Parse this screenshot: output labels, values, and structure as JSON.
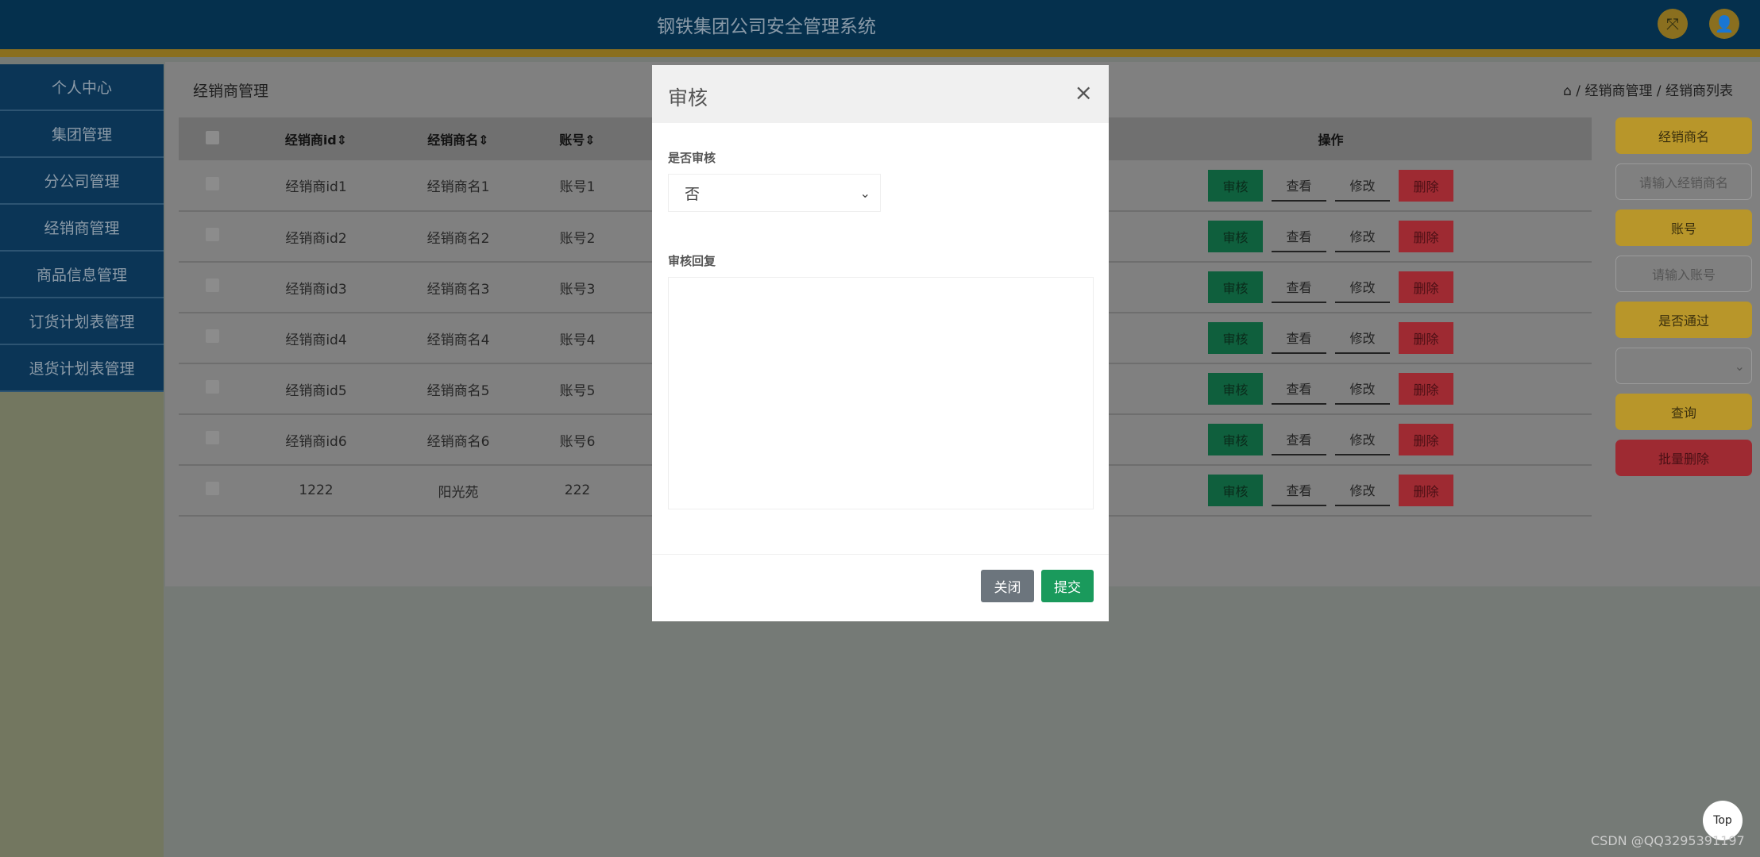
{
  "header": {
    "title": "钢铁集团公司安全管理系统",
    "icons": [
      "fullscreen-icon",
      "user-icon"
    ]
  },
  "sidebar": {
    "items": [
      "个人中心",
      "集团管理",
      "分公司管理",
      "经销商管理",
      "商品信息管理",
      "订货计划表管理",
      "退货计划表管理"
    ]
  },
  "page": {
    "title": "经销商管理",
    "breadcrumb": [
      "经销商管理",
      "经销商列表"
    ]
  },
  "table": {
    "columns": [
      "经销商id",
      "经销商名",
      "账号",
      "操作"
    ],
    "rows": [
      [
        "经销商id1",
        "经销商名1",
        "账号1"
      ],
      [
        "经销商id2",
        "经销商名2",
        "账号2"
      ],
      [
        "经销商id3",
        "经销商名3",
        "账号3"
      ],
      [
        "经销商id4",
        "经销商名4",
        "账号4"
      ],
      [
        "经销商id5",
        "经销商名5",
        "账号5"
      ],
      [
        "经销商id6",
        "经销商名6",
        "账号6"
      ],
      [
        "1222",
        "阳光苑",
        "222"
      ]
    ],
    "actions": [
      "审核",
      "查看",
      "修改",
      "删除"
    ]
  },
  "search": {
    "name_label": "经销商名",
    "name_placeholder": "请输入经销商名",
    "account_label": "账号",
    "account_placeholder": "请输入账号",
    "pass_label": "是否通过",
    "pass_value": "",
    "query": "查询",
    "batch_delete": "批量删除"
  },
  "modal": {
    "title": "审核",
    "close": "×",
    "field1_label": "是否审核",
    "field1_value": "否",
    "field2_label": "审核回复",
    "field2_value": "",
    "cancel": "关闭",
    "submit": "提交"
  },
  "top_button": "Top",
  "watermark": "CSDN @QQ3295391197",
  "colors": {
    "header": "#05304d",
    "accent_gold": "#8a6f1f",
    "approve": "#0f5f3d",
    "delete": "#9e2a32",
    "submit": "#1a9a5c",
    "close": "#6c757d"
  }
}
